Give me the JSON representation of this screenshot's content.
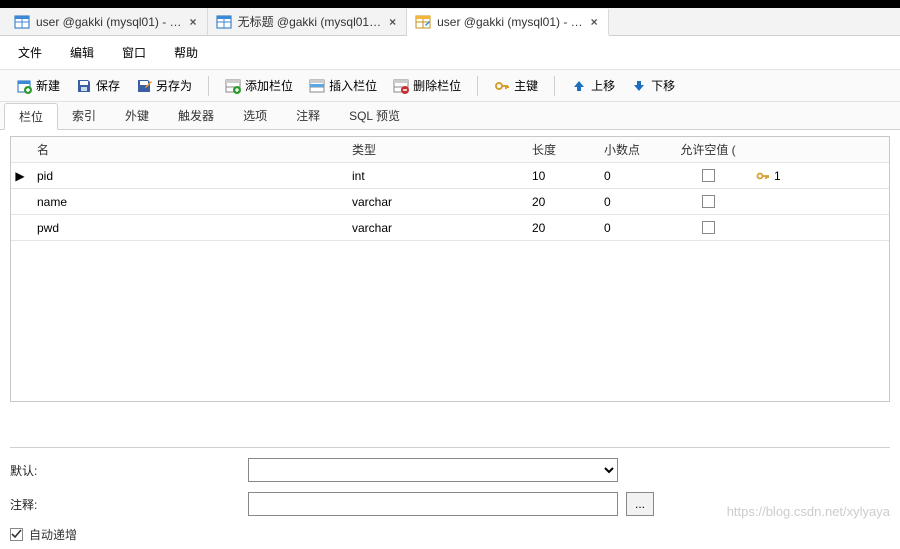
{
  "window_tabs": [
    {
      "label": "user @gakki (mysql01) - …",
      "active": false,
      "icon": "table-blue"
    },
    {
      "label": "无标题 @gakki (mysql01…",
      "active": false,
      "icon": "table-blue"
    },
    {
      "label": "user @gakki (mysql01) - …",
      "active": true,
      "icon": "table-design"
    }
  ],
  "menu": {
    "file": "文件",
    "edit": "编辑",
    "window": "窗口",
    "help": "帮助"
  },
  "toolbar": {
    "new": "新建",
    "save": "保存",
    "saveas": "另存为",
    "addfield": "添加栏位",
    "insertfield": "插入栏位",
    "deletefield": "删除栏位",
    "primarykey": "主键",
    "moveup": "上移",
    "movedown": "下移"
  },
  "subtabs": [
    "栏位",
    "索引",
    "外键",
    "触发器",
    "选项",
    "注释",
    "SQL 预览"
  ],
  "subtab_active": 0,
  "columns": {
    "name": "名",
    "type": "类型",
    "length": "长度",
    "decimals": "小数点",
    "allow_null": "允许空值 ("
  },
  "rows": [
    {
      "name": "pid",
      "type": "int",
      "length": "10",
      "decimals": "0",
      "allow_null": false,
      "pk": "1",
      "current": true
    },
    {
      "name": "name",
      "type": "varchar",
      "length": "20",
      "decimals": "0",
      "allow_null": false,
      "pk": "",
      "current": false
    },
    {
      "name": "pwd",
      "type": "varchar",
      "length": "20",
      "decimals": "0",
      "allow_null": false,
      "pk": "",
      "current": false
    }
  ],
  "form": {
    "default_label": "默认:",
    "comment_label": "注释:",
    "autoinc_label": "自动递增",
    "browse": "..."
  },
  "watermark": "https://blog.csdn.net/xylyaya"
}
